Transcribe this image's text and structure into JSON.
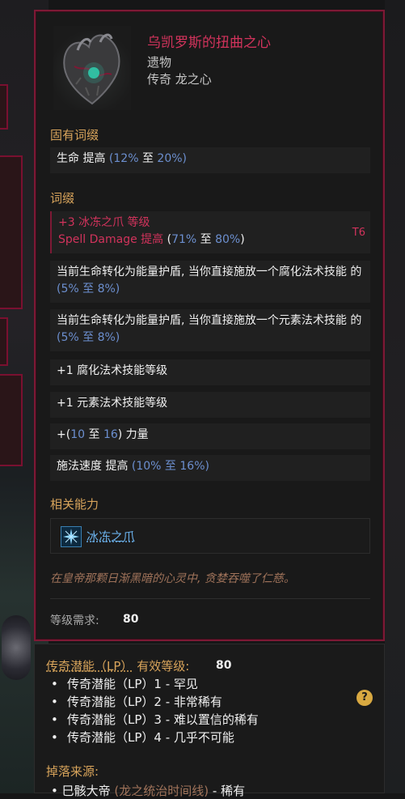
{
  "item": {
    "name": "乌凯罗斯的扭曲之心",
    "type": "遗物",
    "rarity_base": "传奇 龙之心",
    "icon": "twisted-heart-icon"
  },
  "implicit": {
    "label": "固有词缀",
    "rows": [
      {
        "prefix": "生命 提高 ",
        "open": "(",
        "min": "12%",
        "sep": " 至 ",
        "max": "20%",
        "close": ")"
      }
    ]
  },
  "affixes": {
    "label": "词缀",
    "featured": {
      "line1_plus": "+3",
      "line1_text": " 冰冻之爪 等级",
      "line2_text": "Spell Damage 提高 ",
      "line2_open": "(",
      "line2_min": "71%",
      "line2_sep": " 至 ",
      "line2_max": "80%",
      "line2_close": ")",
      "tier": "T6"
    },
    "rows": [
      {
        "text": "当前生命转化为能量护盾, 当你直接施放一个腐化法术技能 的 ",
        "range": "(5% 至 8%)"
      },
      {
        "text": "当前生命转化为能量护盾, 当你直接施放一个元素法术技能 的 ",
        "range": "(5% 至 8%)"
      },
      {
        "plus": "+1",
        "text": " 腐化法术技能等级"
      },
      {
        "plus": "+1",
        "text": " 元素法术技能等级"
      },
      {
        "open": "+(",
        "min": "10",
        "sep": " 至 ",
        "max": "16",
        "close": ") 力量"
      },
      {
        "text": "施法速度 提高 ",
        "range": "(10% 至 16%)"
      }
    ]
  },
  "related": {
    "label": "相关能力",
    "ability_name": "冰冻之爪",
    "ability_icon": "frost-claw-icon"
  },
  "flavor": "在皇帝那颗日渐黑暗的心灵中, 贪婪吞噬了仁慈。",
  "level_req": {
    "label": "等级需求:",
    "value": "80"
  },
  "legendary_potential": {
    "label": "传奇潜能（LP）",
    "label_suffix": "有效等级:",
    "value": "80",
    "items": [
      "传奇潜能（LP）1 - 罕见",
      "传奇潜能（LP）2 - 非常稀有",
      "传奇潜能（LP）3 - 难以置信的稀有",
      "传奇潜能（LP）4 - 几乎不可能"
    ],
    "help": "?"
  },
  "drop_source": {
    "label": "掉落来源:",
    "item_main": "巳骸大帝",
    "item_muted": " (龙之统治时间线)",
    "item_tail": " - 稀有"
  },
  "colors": {
    "legendary": "#d2335c",
    "section": "#d8a45b",
    "range": "#6c8fcf",
    "ability": "#6ab0ea"
  }
}
